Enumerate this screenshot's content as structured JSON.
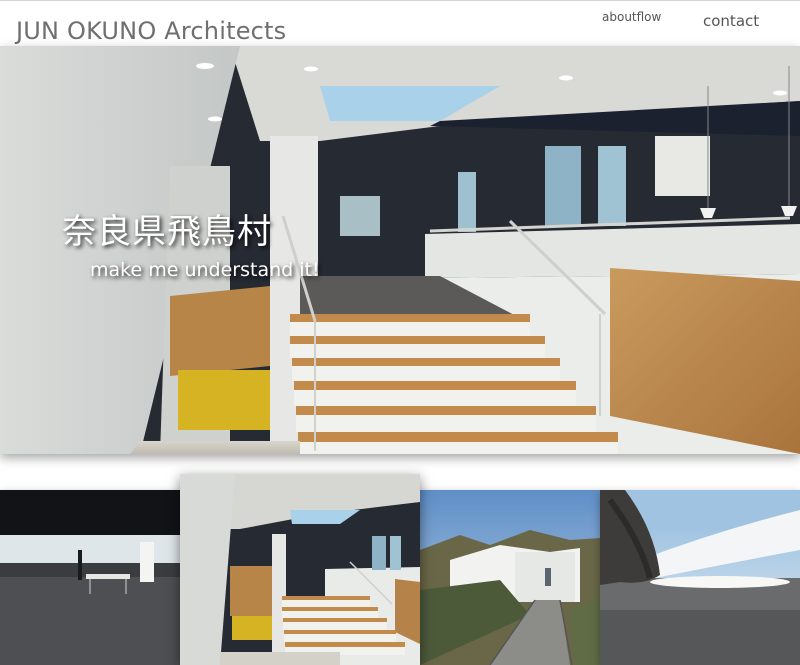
{
  "header": {
    "logo": "JUN OKUNO Architects",
    "nav": {
      "about": "aboutflow",
      "contact": "contact"
    }
  },
  "hero": {
    "title": "奈良県飛鳥村",
    "subtitle": "make me understand it!"
  },
  "colors": {
    "logo_text": "#6f6f6f",
    "nav_text": "#555555",
    "hero_text": "#ffffff",
    "wood": "#b5824a",
    "dark_ceiling": "#1e2330"
  },
  "thumbnails": [
    {
      "subject": "dark interior room with table"
    },
    {
      "subject": "staircase interior"
    },
    {
      "subject": "white building exterior on hillside"
    },
    {
      "subject": "curved concrete opening with sky"
    }
  ]
}
